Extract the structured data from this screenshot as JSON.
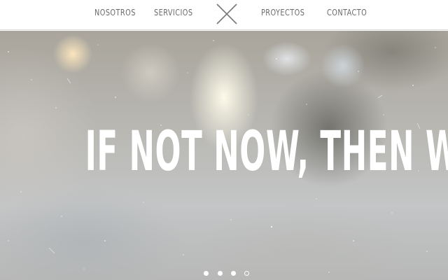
{
  "nav": {
    "items": [
      {
        "label": "NOSOTROS"
      },
      {
        "label": "SERVICIOS"
      },
      {
        "label": "PROYECTOS"
      },
      {
        "label": "CONTACTO"
      }
    ],
    "logo_icon": "x-logo-icon"
  },
  "hero": {
    "headline": "IF NOT NOW, THEN WHEN.",
    "slides_total": 4,
    "active_slide": 4
  },
  "colors": {
    "nav_text": "#6b6b6b",
    "nav_background": "#ffffff",
    "headline": "#ffffff"
  }
}
